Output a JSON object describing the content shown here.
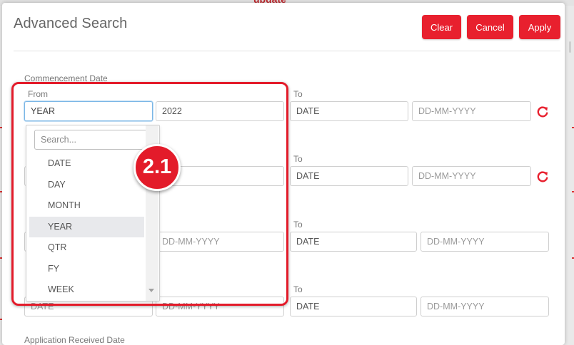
{
  "background": {
    "peek_text": "update"
  },
  "modal": {
    "title": "Advanced Search",
    "buttons": {
      "clear": "Clear",
      "cancel": "Cancel",
      "apply": "Apply"
    },
    "accent_color": "#e8202e"
  },
  "commencement": {
    "label": "Commencement Date",
    "from_label": "From",
    "to_label": "To",
    "from_type": "YEAR",
    "from_value": "2022",
    "to_type": "DATE",
    "to_placeholder": "DD-MM-YYYY"
  },
  "row2": {
    "to_label": "To",
    "to_type": "DATE",
    "to_placeholder": "DD-MM-YYYY"
  },
  "row3": {
    "from_placeholder": "DD-MM-YYYY",
    "to_label": "To",
    "to_type": "DATE",
    "to_placeholder": "DD-MM-YYYY"
  },
  "row4": {
    "from_type": "DATE",
    "from_placeholder": "DD-MM-YYYY",
    "to_label": "To",
    "to_type": "DATE",
    "to_placeholder": "DD-MM-YYYY"
  },
  "dropdown": {
    "search_placeholder": "Search...",
    "options": [
      "DATE",
      "DAY",
      "MONTH",
      "YEAR",
      "QTR",
      "FY",
      "WEEK"
    ],
    "selected": "YEAR"
  },
  "annotation": {
    "step": "2.1",
    "color": "#e31b2a"
  },
  "cutoff_label": "Application Received Date"
}
